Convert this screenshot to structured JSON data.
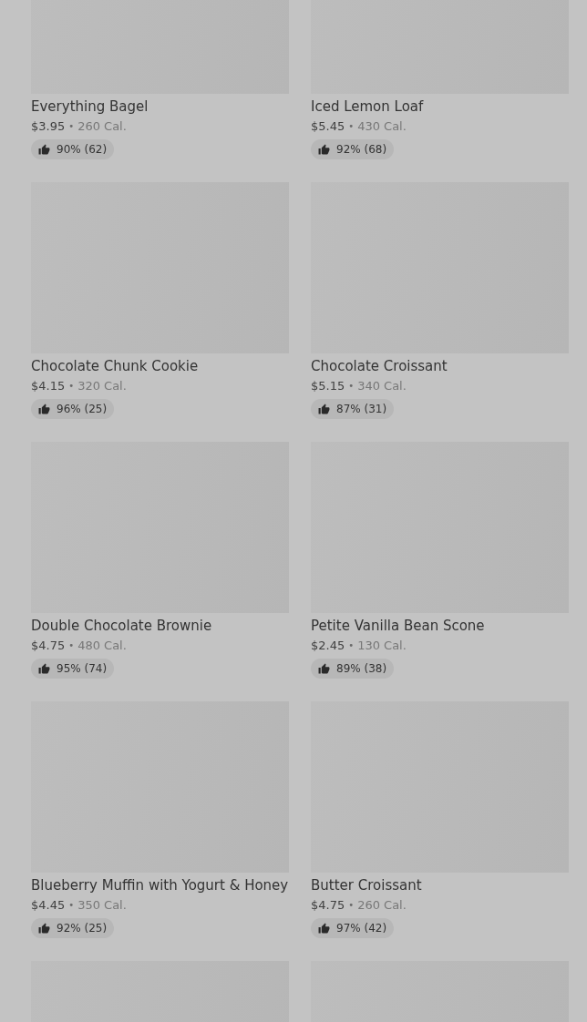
{
  "items": [
    {
      "kind": "full",
      "name": "Everything Bagel",
      "price": "$3.95",
      "separator": "•",
      "calories": "260 Cal.",
      "rating": "90% (62)"
    },
    {
      "kind": "full",
      "name": "Iced Lemon Loaf",
      "price": "$5.45",
      "separator": "•",
      "calories": "430 Cal.",
      "rating": "92% (68)"
    },
    {
      "kind": "full",
      "name": "Chocolate Chunk Cookie",
      "price": "$4.15",
      "separator": "•",
      "calories": "320 Cal.",
      "rating": "96% (25)"
    },
    {
      "kind": "full",
      "name": "Chocolate Croissant",
      "price": "$5.15",
      "separator": "•",
      "calories": "340 Cal.",
      "rating": "87% (31)"
    },
    {
      "kind": "full",
      "name": "Double Chocolate Brownie",
      "price": "$4.75",
      "separator": "•",
      "calories": "480 Cal.",
      "rating": "95% (74)"
    },
    {
      "kind": "full",
      "name": "Petite Vanilla Bean Scone",
      "price": "$2.45",
      "separator": "•",
      "calories": "130 Cal.",
      "rating": "89% (38)"
    },
    {
      "kind": "full",
      "name": "Blueberry Muffin with Yogurt & Honey",
      "price": "$4.45",
      "separator": "•",
      "calories": "350 Cal.",
      "rating": "92% (25)"
    },
    {
      "kind": "full",
      "name": "Butter Croissant",
      "price": "$4.75",
      "separator": "•",
      "calories": "260 Cal.",
      "rating": "97% (42)"
    },
    {
      "kind": "image-only"
    },
    {
      "kind": "image-only"
    }
  ]
}
